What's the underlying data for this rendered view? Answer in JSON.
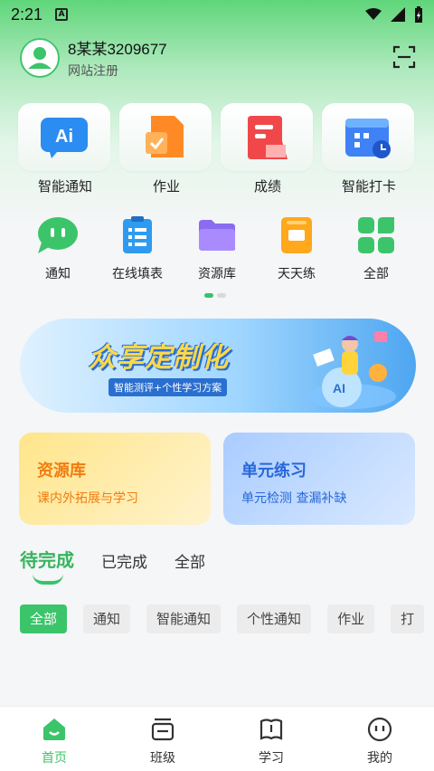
{
  "status": {
    "time": "2:21"
  },
  "profile": {
    "username": "8某某3209677",
    "subtitle": "网站注册"
  },
  "big_grid": [
    {
      "label": "智能通知",
      "icon": "ai-notice-icon"
    },
    {
      "label": "作业",
      "icon": "homework-icon"
    },
    {
      "label": "成绩",
      "icon": "grades-icon"
    },
    {
      "label": "智能打卡",
      "icon": "checkin-calendar-icon"
    }
  ],
  "small_grid": [
    {
      "label": "通知",
      "icon": "chat-bubble-icon"
    },
    {
      "label": "在线填表",
      "icon": "clipboard-form-icon"
    },
    {
      "label": "资源库",
      "icon": "folder-icon"
    },
    {
      "label": "天天练",
      "icon": "practice-book-icon"
    },
    {
      "label": "全部",
      "icon": "all-apps-icon"
    }
  ],
  "banner": {
    "title": "众享定制化",
    "subtitle": "智能测评+个性学习方案"
  },
  "cards": [
    {
      "title": "资源库",
      "subtitle": "课内外拓展与学习"
    },
    {
      "title": "单元练习",
      "subtitle": "单元检测  查漏补缺"
    }
  ],
  "tabs": [
    "待完成",
    "已完成",
    "全部"
  ],
  "filters": [
    "全部",
    "通知",
    "智能通知",
    "个性通知",
    "作业",
    "打"
  ],
  "bottom_nav": [
    {
      "label": "首页",
      "icon": "home-icon"
    },
    {
      "label": "班级",
      "icon": "class-icon"
    },
    {
      "label": "学习",
      "icon": "book-icon"
    },
    {
      "label": "我的",
      "icon": "profile-face-icon"
    }
  ],
  "colors": {
    "accent": "#3cc46a",
    "orange": "#f07c10",
    "blue": "#2767d8"
  }
}
